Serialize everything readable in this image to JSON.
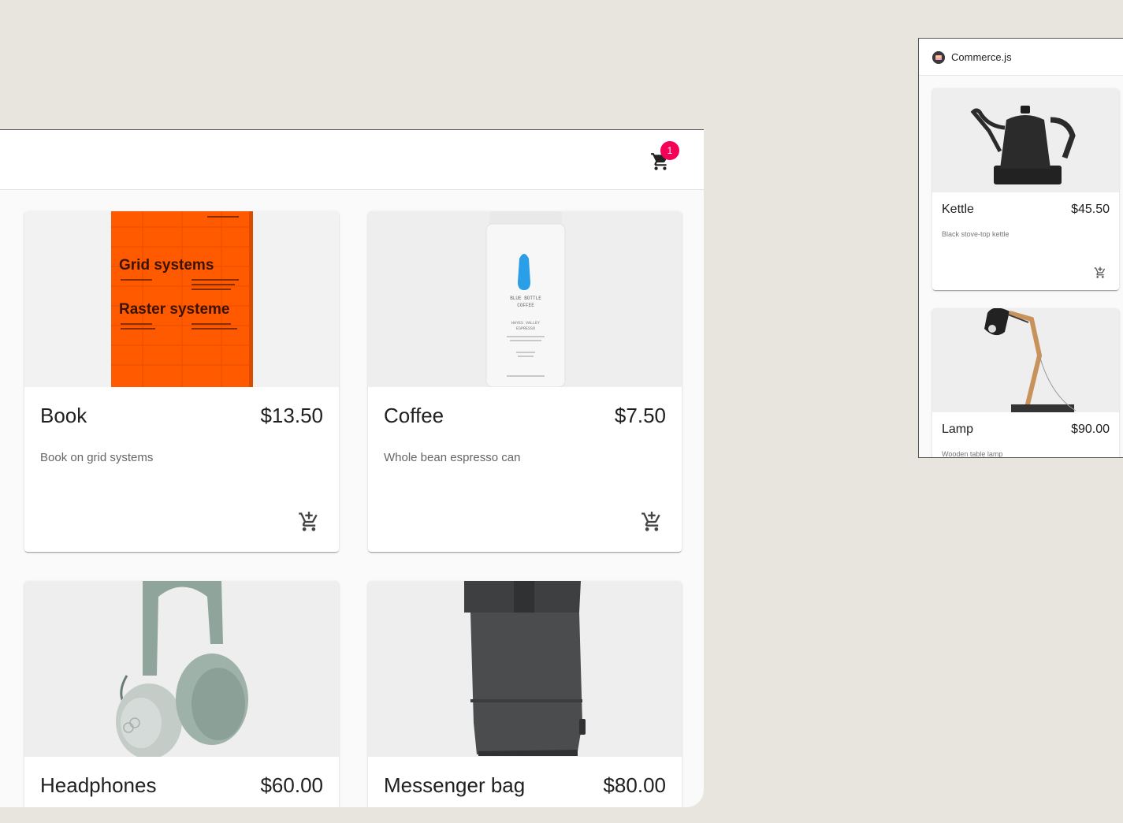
{
  "main": {
    "cart_count": "1",
    "products": [
      {
        "name": "Book",
        "price": "$13.50",
        "description": "Book on grid systems",
        "cover_title_1": "Grid systems",
        "cover_title_2": "Raster systeme"
      },
      {
        "name": "Coffee",
        "price": "$7.50",
        "description": "Whole bean espresso can",
        "label_1": "BLUE BOTTLE",
        "label_2": "COFFEE",
        "label_3": "HAYES VALLEY",
        "label_4": "ESPRESSO"
      },
      {
        "name": "Headphones",
        "price": "$60.00",
        "description": ""
      },
      {
        "name": "Messenger bag",
        "price": "$80.00",
        "description": ""
      }
    ]
  },
  "mini": {
    "title": "Commerce.js",
    "products": [
      {
        "name": "Kettle",
        "price": "$45.50",
        "description": "Black stove-top kettle"
      },
      {
        "name": "Lamp",
        "price": "$90.00",
        "description": "Wooden table lamp"
      }
    ]
  },
  "colors": {
    "background": "#e8e5df",
    "badge": "#f50057",
    "book_orange": "#ff5a00"
  },
  "icons": [
    "cart-icon",
    "add-to-cart-icon",
    "commerce-logo-icon"
  ]
}
